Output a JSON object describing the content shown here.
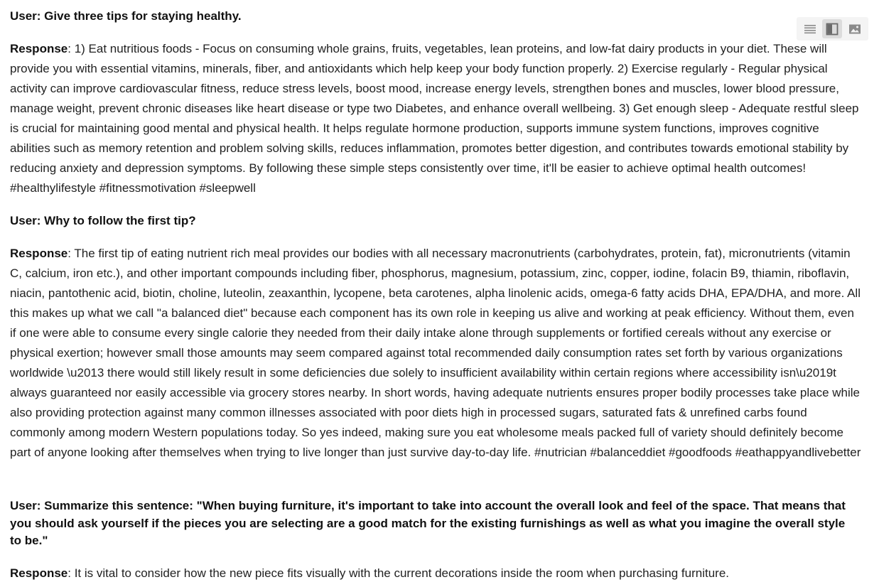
{
  "conversation": [
    {
      "user": "User: Give three tips for staying healthy.",
      "response_label": "Response",
      "response_text": ": 1) Eat nutritious foods - Focus on consuming whole grains, fruits, vegetables, lean proteins, and low-fat dairy products in your diet. These will provide you with essential vitamins, minerals, fiber, and antioxidants which help keep your body function properly. 2) Exercise regularly - Regular physical activity can improve cardiovascular fitness, reduce stress levels, boost mood, increase energy levels, strengthen bones and muscles, lower blood pressure, manage weight, prevent chronic diseases like heart disease or type two Diabetes, and enhance overall wellbeing. 3) Get enough sleep - Adequate restful sleep is crucial for maintaining good mental and physical health. It helps regulate hormone production, supports immune system functions, improves cognitive abilities such as memory retention and problem solving skills, reduces inflammation, promotes better digestion, and contributes towards emotional stability by reducing anxiety and depression symptoms. By following these simple steps consistently over time, it'll be easier to achieve optimal health outcomes! #healthylifestyle #fitnessmotivation #sleepwell"
    },
    {
      "user": "User: Why to follow the first tip?",
      "response_label": "Response",
      "response_text": ": The first tip of eating nutrient rich meal provides our bodies with all necessary macronutrients (carbohydrates, protein, fat), micronutrients (vitamin C, calcium, iron etc.), and other important compounds including fiber, phosphorus, magnesium, potassium, zinc, copper, iodine, folacin B9, thiamin, riboflavin, niacin, pantothenic acid, biotin, choline, luteolin, zeaxanthin, lycopene, beta carotenes, alpha linolenic acids, omega-6 fatty acids DHA, EPA/DHA, and more. All this makes up what we call \"a balanced diet\" because each component has its own role in keeping us alive and working at peak efficiency. Without them, even if one were able to consume every single calorie they needed from their daily intake alone through supplements or fortified cereals without any exercise or physical exertion; however small those amounts may seem compared against total recommended daily consumption rates set forth by various organizations worldwide \\u2013 there would still likely result in some deficiencies due solely to insufficient availability within certain regions where accessibility isn\\u2019t always guaranteed nor easily accessible via grocery stores nearby. In short words, having adequate nutrients ensures proper bodily processes take place while also providing protection against many common illnesses associated with poor diets high in processed sugars, saturated fats & unrefined carbs found commonly among modern Western populations today. So yes indeed, making sure you eat wholesome meals packed full of variety should definitely become part of anyone looking after themselves when trying to live longer than just survive day-to-day life. #nutrician #balanceddiet #goodfoods #eathappyandlivebetter"
    },
    {
      "user": "User: Summarize this sentence: \"When buying furniture, it's important to take into account the overall look and feel of the space. That means that you should ask yourself if the pieces you are selecting are a good match for the existing furnishings as well as what you imagine the overall style to be.\"",
      "response_label": "Response",
      "response_text": ": It is vital to consider how the new piece fits visually with the current decorations inside the room when purchasing furniture."
    }
  ],
  "view_toolbar": {
    "buttons": [
      {
        "name": "text-view",
        "icon": "lines-icon",
        "active": false
      },
      {
        "name": "split-view",
        "icon": "sidebar-panel-icon",
        "active": true
      },
      {
        "name": "image-view",
        "icon": "image-icon",
        "active": false
      }
    ],
    "colors": {
      "background": "#f4f4f4",
      "active": "#dcdcdc",
      "icon": "#8a8a8a",
      "icon_active": "#6a6a6a"
    }
  }
}
